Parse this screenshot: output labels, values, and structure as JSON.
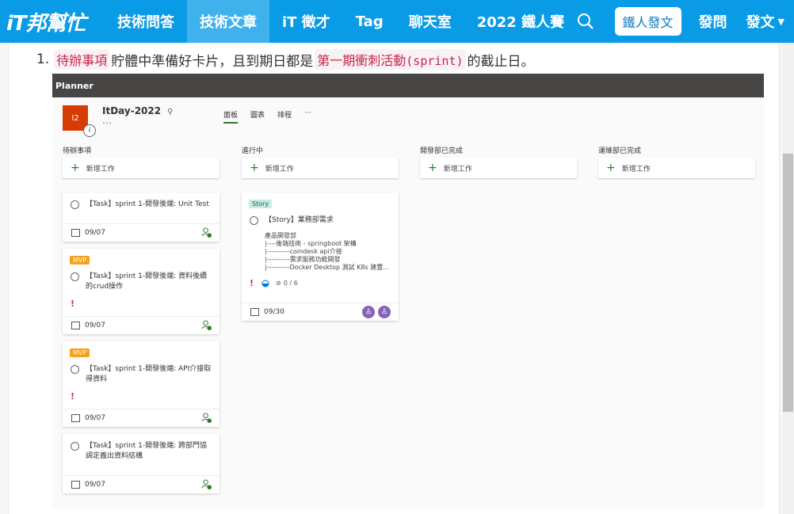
{
  "nav": {
    "logo": "iT邦幫忙",
    "items": [
      "技術問答",
      "技術文章",
      "iT 徵才",
      "Tag",
      "聊天室",
      "2022 鐵人賽"
    ],
    "active_index": 1,
    "post_button": "鐵人發文",
    "ask": "發問",
    "write": "發文"
  },
  "article": {
    "list_number": "1.",
    "code1": "待辦事項",
    "text1": "貯體中準備好卡片，且到期日都是",
    "code2_cjk": "第一期衝刺活動",
    "code2_en": "(sprint)",
    "text2": "的截止日。"
  },
  "planner": {
    "app_name": "Planner",
    "plan_avatar": "I2",
    "plan_name": "ItDay-2022",
    "more": "…",
    "tabs": [
      "面板",
      "圖表",
      "排程",
      "···"
    ],
    "add_task_label": "新增工作",
    "columns": [
      {
        "title": "待辦事項",
        "cards": [
          {
            "title": "【Task】sprint 1-開發後端: Unit Test",
            "date": "09/07"
          },
          {
            "label": "MVP",
            "title": "【Task】sprint 1-開發後端: 資料後續的crud操作",
            "date": "09/07"
          },
          {
            "label": "MVP",
            "title": "【Task】sprint 1-開發後端: API介接取得資料",
            "date": "09/07"
          },
          {
            "title": "【Task】sprint 1-開發後端: 跨部門協調定義出資料結構",
            "date": "09/07"
          }
        ]
      },
      {
        "title": "進行中",
        "cards": [
          {
            "label": "Story",
            "title": "【Story】業務部需求",
            "notes": [
              "產品開發部",
              "|----後端技術 - springboot 架構",
              "|----------coindesk api介接",
              "|----------需求服務功能開發",
              "|----------Docker Desktop 測試 K8s 建置..."
            ],
            "checklist": "0 / 6",
            "date": "09/30"
          }
        ]
      },
      {
        "title": "開發部已完成",
        "cards": []
      },
      {
        "title": "運維部已完成",
        "cards": []
      }
    ]
  },
  "colors": {
    "nav_bg": "#0a9be6",
    "active_tab": "#3fb1ec",
    "code_text": "#c7254e",
    "mvp": "#f7a01c",
    "story": "#c6ebe3",
    "planner_bar": "#484644"
  }
}
